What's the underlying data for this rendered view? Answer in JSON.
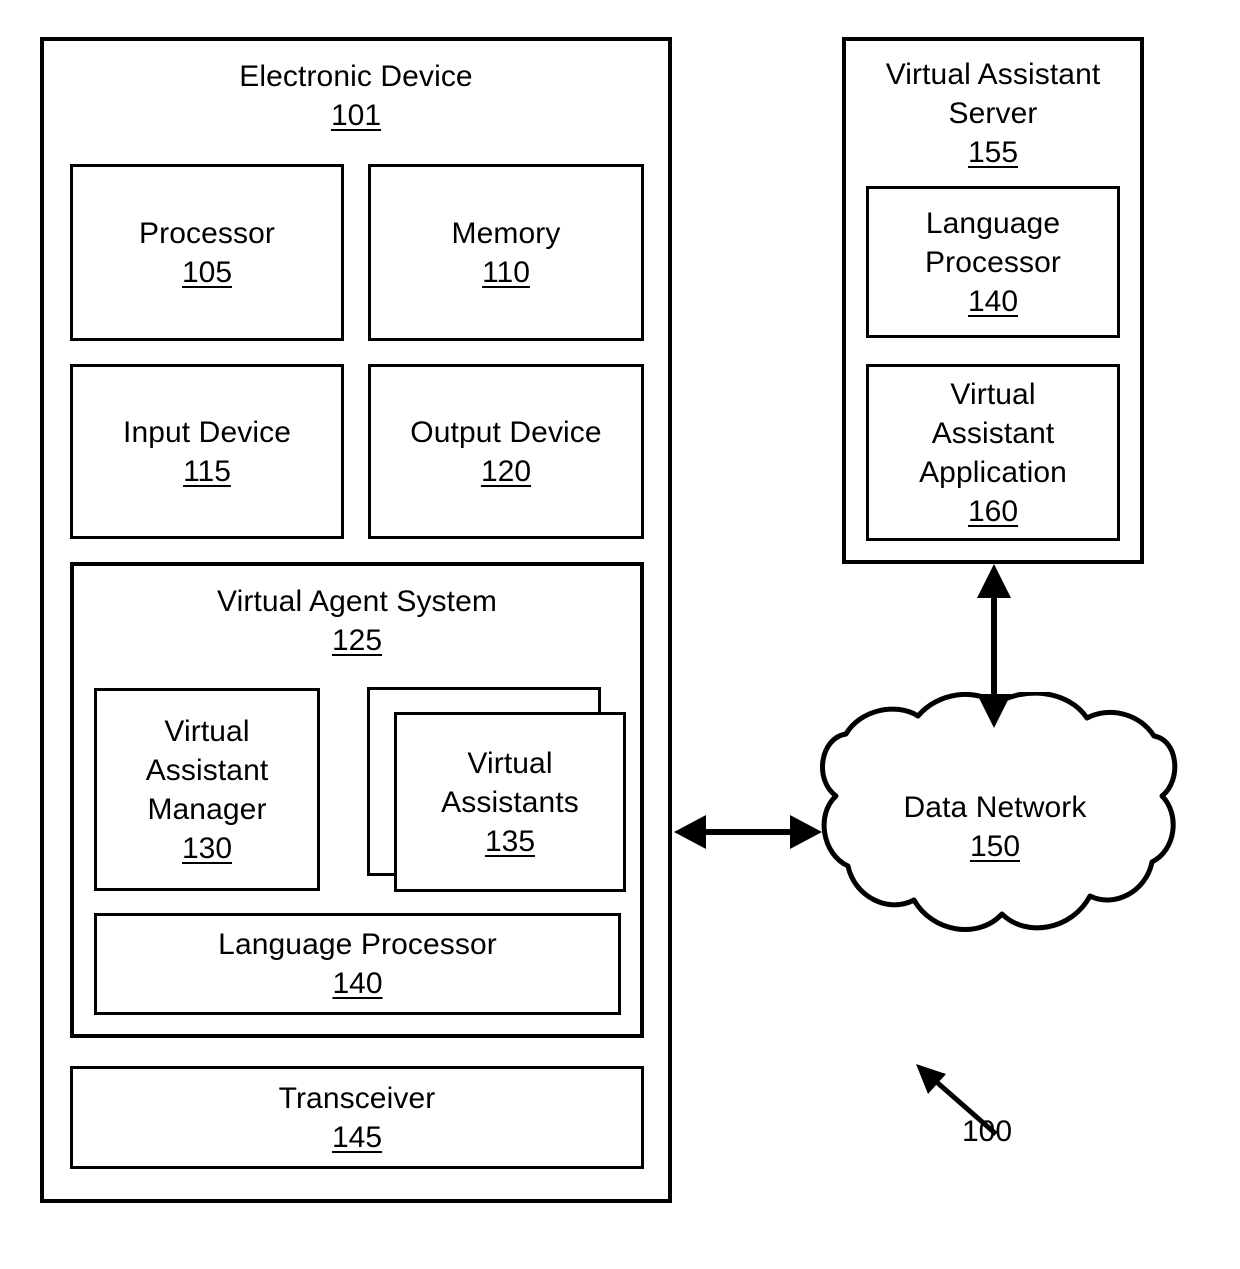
{
  "figure": {
    "reference_label": "100",
    "background_color": "#ffffff",
    "line_color": "#000000"
  },
  "electronic_device": {
    "title": "Electronic Device",
    "ref": "101",
    "components": [
      {
        "name": "processor",
        "title": "Processor",
        "ref": "105"
      },
      {
        "name": "memory",
        "title": "Memory",
        "ref": "110"
      },
      {
        "name": "input-device",
        "title": "Input Device",
        "ref": "115"
      },
      {
        "name": "output-device",
        "title": "Output Device",
        "ref": "120"
      },
      {
        "name": "transceiver",
        "title": "Transceiver",
        "ref": "145"
      }
    ],
    "virtual_agent_system": {
      "title": "Virtual Agent System",
      "ref": "125",
      "components": [
        {
          "name": "virtual-assistant-manager",
          "title": "Virtual\nAssistant\nManager",
          "ref": "130",
          "stacked": false
        },
        {
          "name": "virtual-assistants",
          "title": "Virtual\nAssistants",
          "ref": "135",
          "stacked": true
        },
        {
          "name": "language-processor",
          "title": "Language Processor",
          "ref": "140",
          "stacked": false
        }
      ]
    }
  },
  "virtual_assistant_server": {
    "title": "Virtual Assistant\nServer",
    "ref": "155",
    "components": [
      {
        "name": "language-processor",
        "title": "Language\nProcessor",
        "ref": "140"
      },
      {
        "name": "virtual-assistant-application",
        "title": "Virtual\nAssistant\nApplication",
        "ref": "160"
      }
    ]
  },
  "data_network": {
    "title": "Data Network",
    "ref": "150",
    "shape": "cloud"
  },
  "connections": [
    {
      "name": "device-to-network",
      "from": "Electronic Device 101",
      "to": "Data Network 150",
      "style": "double-headed-horizontal-arrow"
    },
    {
      "name": "network-to-server",
      "from": "Data Network 150",
      "to": "Virtual Assistant Server 155",
      "style": "double-headed-vertical-arrow"
    },
    {
      "name": "figure-reference-pointer",
      "from": "100",
      "to": "system diagram",
      "style": "single-headed-diagonal-arrow"
    }
  ]
}
